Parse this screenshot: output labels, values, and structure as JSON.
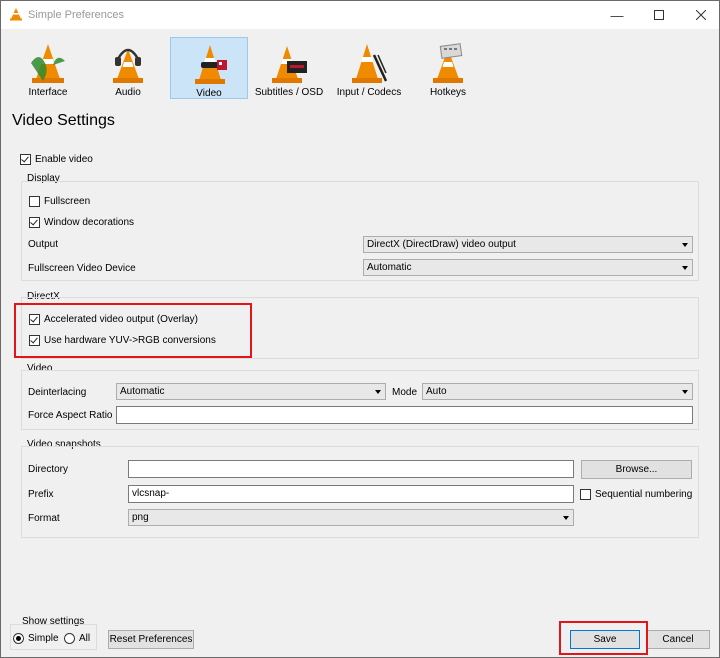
{
  "window": {
    "title": "Simple Preferences"
  },
  "categories": [
    "Interface",
    "Audio",
    "Video",
    "Subtitles / OSD",
    "Input / Codecs",
    "Hotkeys"
  ],
  "selected_category": "Video",
  "page_title": "Video Settings",
  "enable_video": {
    "label": "Enable video",
    "checked": true
  },
  "display": {
    "title": "Display",
    "fullscreen": {
      "label": "Fullscreen",
      "checked": false
    },
    "window_decorations": {
      "label": "Window decorations",
      "checked": true
    },
    "output_label": "Output",
    "output_value": "DirectX (DirectDraw) video output",
    "fs_device_label": "Fullscreen Video Device",
    "fs_device_value": "Automatic"
  },
  "directx": {
    "title": "DirectX",
    "overlay": {
      "label": "Accelerated video output (Overlay)",
      "checked": true
    },
    "yuv": {
      "label": "Use hardware YUV->RGB conversions",
      "checked": true
    }
  },
  "video": {
    "title": "Video",
    "deinterlacing_label": "Deinterlacing",
    "deinterlacing_value": "Automatic",
    "mode_label": "Mode",
    "mode_value": "Auto",
    "aspect_label": "Force Aspect Ratio",
    "aspect_value": ""
  },
  "snapshots": {
    "title": "Video snapshots",
    "directory_label": "Directory",
    "directory_value": "",
    "browse_label": "Browse...",
    "prefix_label": "Prefix",
    "prefix_value": "vlcsnap-",
    "sequential": {
      "label": "Sequential numbering",
      "checked": false
    },
    "format_label": "Format",
    "format_value": "png"
  },
  "show_settings": {
    "title": "Show settings",
    "simple_label": "Simple",
    "all_label": "All",
    "selected": "Simple"
  },
  "buttons": {
    "reset": "Reset Preferences",
    "save": "Save",
    "cancel": "Cancel"
  },
  "colors": {
    "highlight_box": "#e4141b",
    "selected_tab": "#cce4f7",
    "cone_orange": "#f08a00"
  }
}
